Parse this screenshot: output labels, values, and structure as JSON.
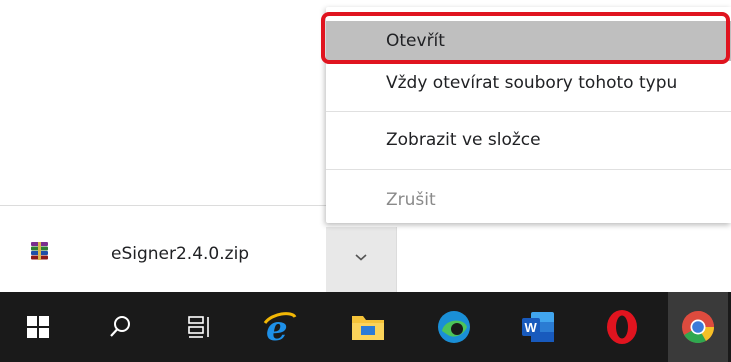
{
  "download_shelf": {
    "file_name": "eSigner2.4.0.zip",
    "file_icon": "winrar-archive-icon",
    "chevron_icon": "chevron-down-icon"
  },
  "context_menu": {
    "items": [
      {
        "label": "Otevřít",
        "state": "highlighted"
      },
      {
        "label": "Vždy otevírat soubory tohoto typu",
        "state": "normal"
      },
      {
        "label": "Zobrazit ve složce",
        "state": "normal"
      },
      {
        "label": "Zrušit",
        "state": "disabled"
      }
    ],
    "highlight_frame_color": "#e0141f"
  },
  "taskbar": {
    "items": [
      {
        "icon": "windows-start-icon"
      },
      {
        "icon": "search-icon"
      },
      {
        "icon": "task-view-icon"
      },
      {
        "icon": "internet-explorer-icon"
      },
      {
        "icon": "file-explorer-icon"
      },
      {
        "icon": "edge-icon"
      },
      {
        "icon": "word-icon",
        "badge": "W"
      },
      {
        "icon": "opera-icon"
      },
      {
        "icon": "chrome-icon",
        "state": "active"
      }
    ]
  },
  "colors": {
    "taskbar_bg": "#1a1a1a",
    "menu_highlight": "#bfbfbf",
    "annotation_red": "#e0141f"
  }
}
